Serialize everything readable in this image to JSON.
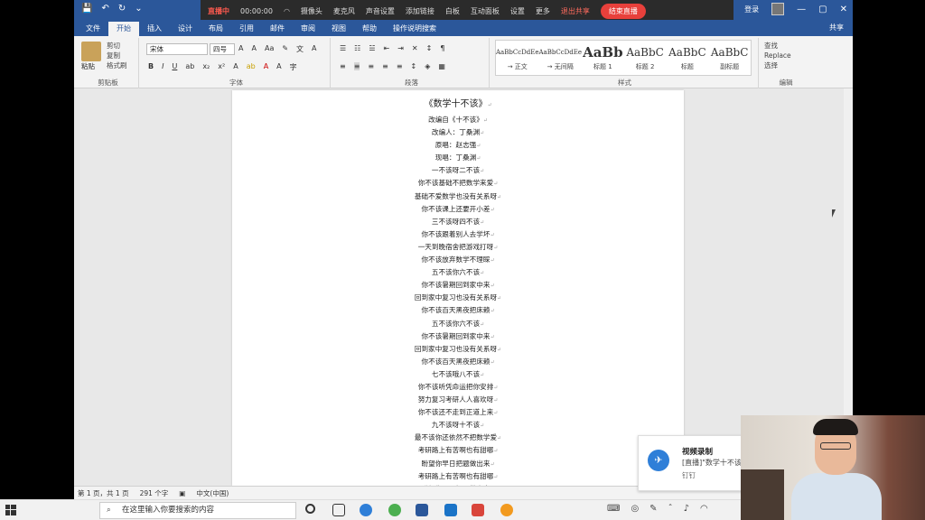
{
  "qat": {
    "save": "💾",
    "undo": "↶",
    "redo": "↻",
    "more": "⌄"
  },
  "meeting": {
    "status": "直播中",
    "timer": "00:00:00",
    "net": "◠",
    "camera_label": "摄像头",
    "mic_label": "麦克风",
    "audio_settings": "声音设置",
    "add_link": "添加链接",
    "whiteboard": "白板",
    "interactive_panel": "互动面板",
    "settings": "设置",
    "more": "更多",
    "exit_share": "退出共享",
    "end_stream": "结束直播"
  },
  "titlebar_user": "登录",
  "window_controls": {
    "min": "—",
    "max": "▢",
    "close": "✕"
  },
  "tabs": [
    {
      "label": "文件"
    },
    {
      "label": "开始",
      "active": true
    },
    {
      "label": "插入"
    },
    {
      "label": "设计"
    },
    {
      "label": "布局"
    },
    {
      "label": "引用"
    },
    {
      "label": "邮件"
    },
    {
      "label": "审阅"
    },
    {
      "label": "视图"
    },
    {
      "label": "帮助"
    },
    {
      "label": "操作说明搜索"
    }
  ],
  "share": "共享",
  "ribbon": {
    "clipboard": {
      "paste": "粘贴",
      "cut": "剪切",
      "copy": "复制",
      "format_painter": "格式刷",
      "label": "剪贴板"
    },
    "font": {
      "name": "宋体",
      "size": "四号",
      "label": "字体"
    },
    "paragraph": {
      "label": "段落"
    },
    "styles": {
      "label": "样式",
      "items": [
        {
          "preview": "AaBbCcDdEe",
          "name": "→ 正文",
          "size": "7"
        },
        {
          "preview": "AaBbCcDdEe",
          "name": "→ 无间隔",
          "size": "7"
        },
        {
          "preview": "AaBb",
          "name": "标题 1",
          "size": "15"
        },
        {
          "preview": "AaBbC",
          "name": "标题 2",
          "size": "12"
        },
        {
          "preview": "AaBbC",
          "name": "标题",
          "size": "12"
        },
        {
          "preview": "AaBbC",
          "name": "副标题",
          "size": "12"
        }
      ]
    },
    "editing": {
      "find": "查找",
      "replace": "Replace",
      "select": "选择",
      "label": "编辑"
    }
  },
  "document": {
    "title": "《数学十不该》",
    "lines": [
      "改编自《十不该》",
      "改编人：丁桑渊",
      "原唱：赵志强",
      "现唱：丁桑渊",
      "一不该呀二不该",
      "你不该基础不把数学来爱",
      "基础不爱数学也没有关系呀",
      "你不该课上还要开小差",
      "三不该呀四不该",
      "你不该跟着别人去学坏",
      "一天到晚宿舍把游戏打呀",
      "你不该放弃数学不理睬",
      "五不该你六不该",
      "你不该暑期回到家中来",
      "回到家中复习也没有关系呀",
      "你不该百天黑夜把床赖",
      "五不该你六不该",
      "你不该暑期回到家中来",
      "回到家中复习也没有关系呀",
      "你不该百天黑夜把床赖",
      "七不该哦八不该",
      "你不该听凭命运把你安排",
      "努力复习考研人人喜欢呀",
      "你不该还不走到正道上来",
      "九不该呀十不该",
      "最不该你还依然不把数学爱",
      "考研路上有苦啊也有甜哪",
      "盼望你早日把题做出来",
      "考研路上有苦啊也有甜哪",
      "盼望你早日把题做出来"
    ]
  },
  "statusbar": {
    "page": "第 1 页，共 1 页",
    "words": "291 个字",
    "lang": "中文(中国)"
  },
  "taskbar": {
    "search_placeholder": "在这里输入你要搜索的内容"
  },
  "toast": {
    "title": "视频录制",
    "body": "[直播]\"数学十不该\"",
    "app": "钉钉"
  },
  "colors": {
    "accent": "#2b579a",
    "live": "#e8403b"
  }
}
